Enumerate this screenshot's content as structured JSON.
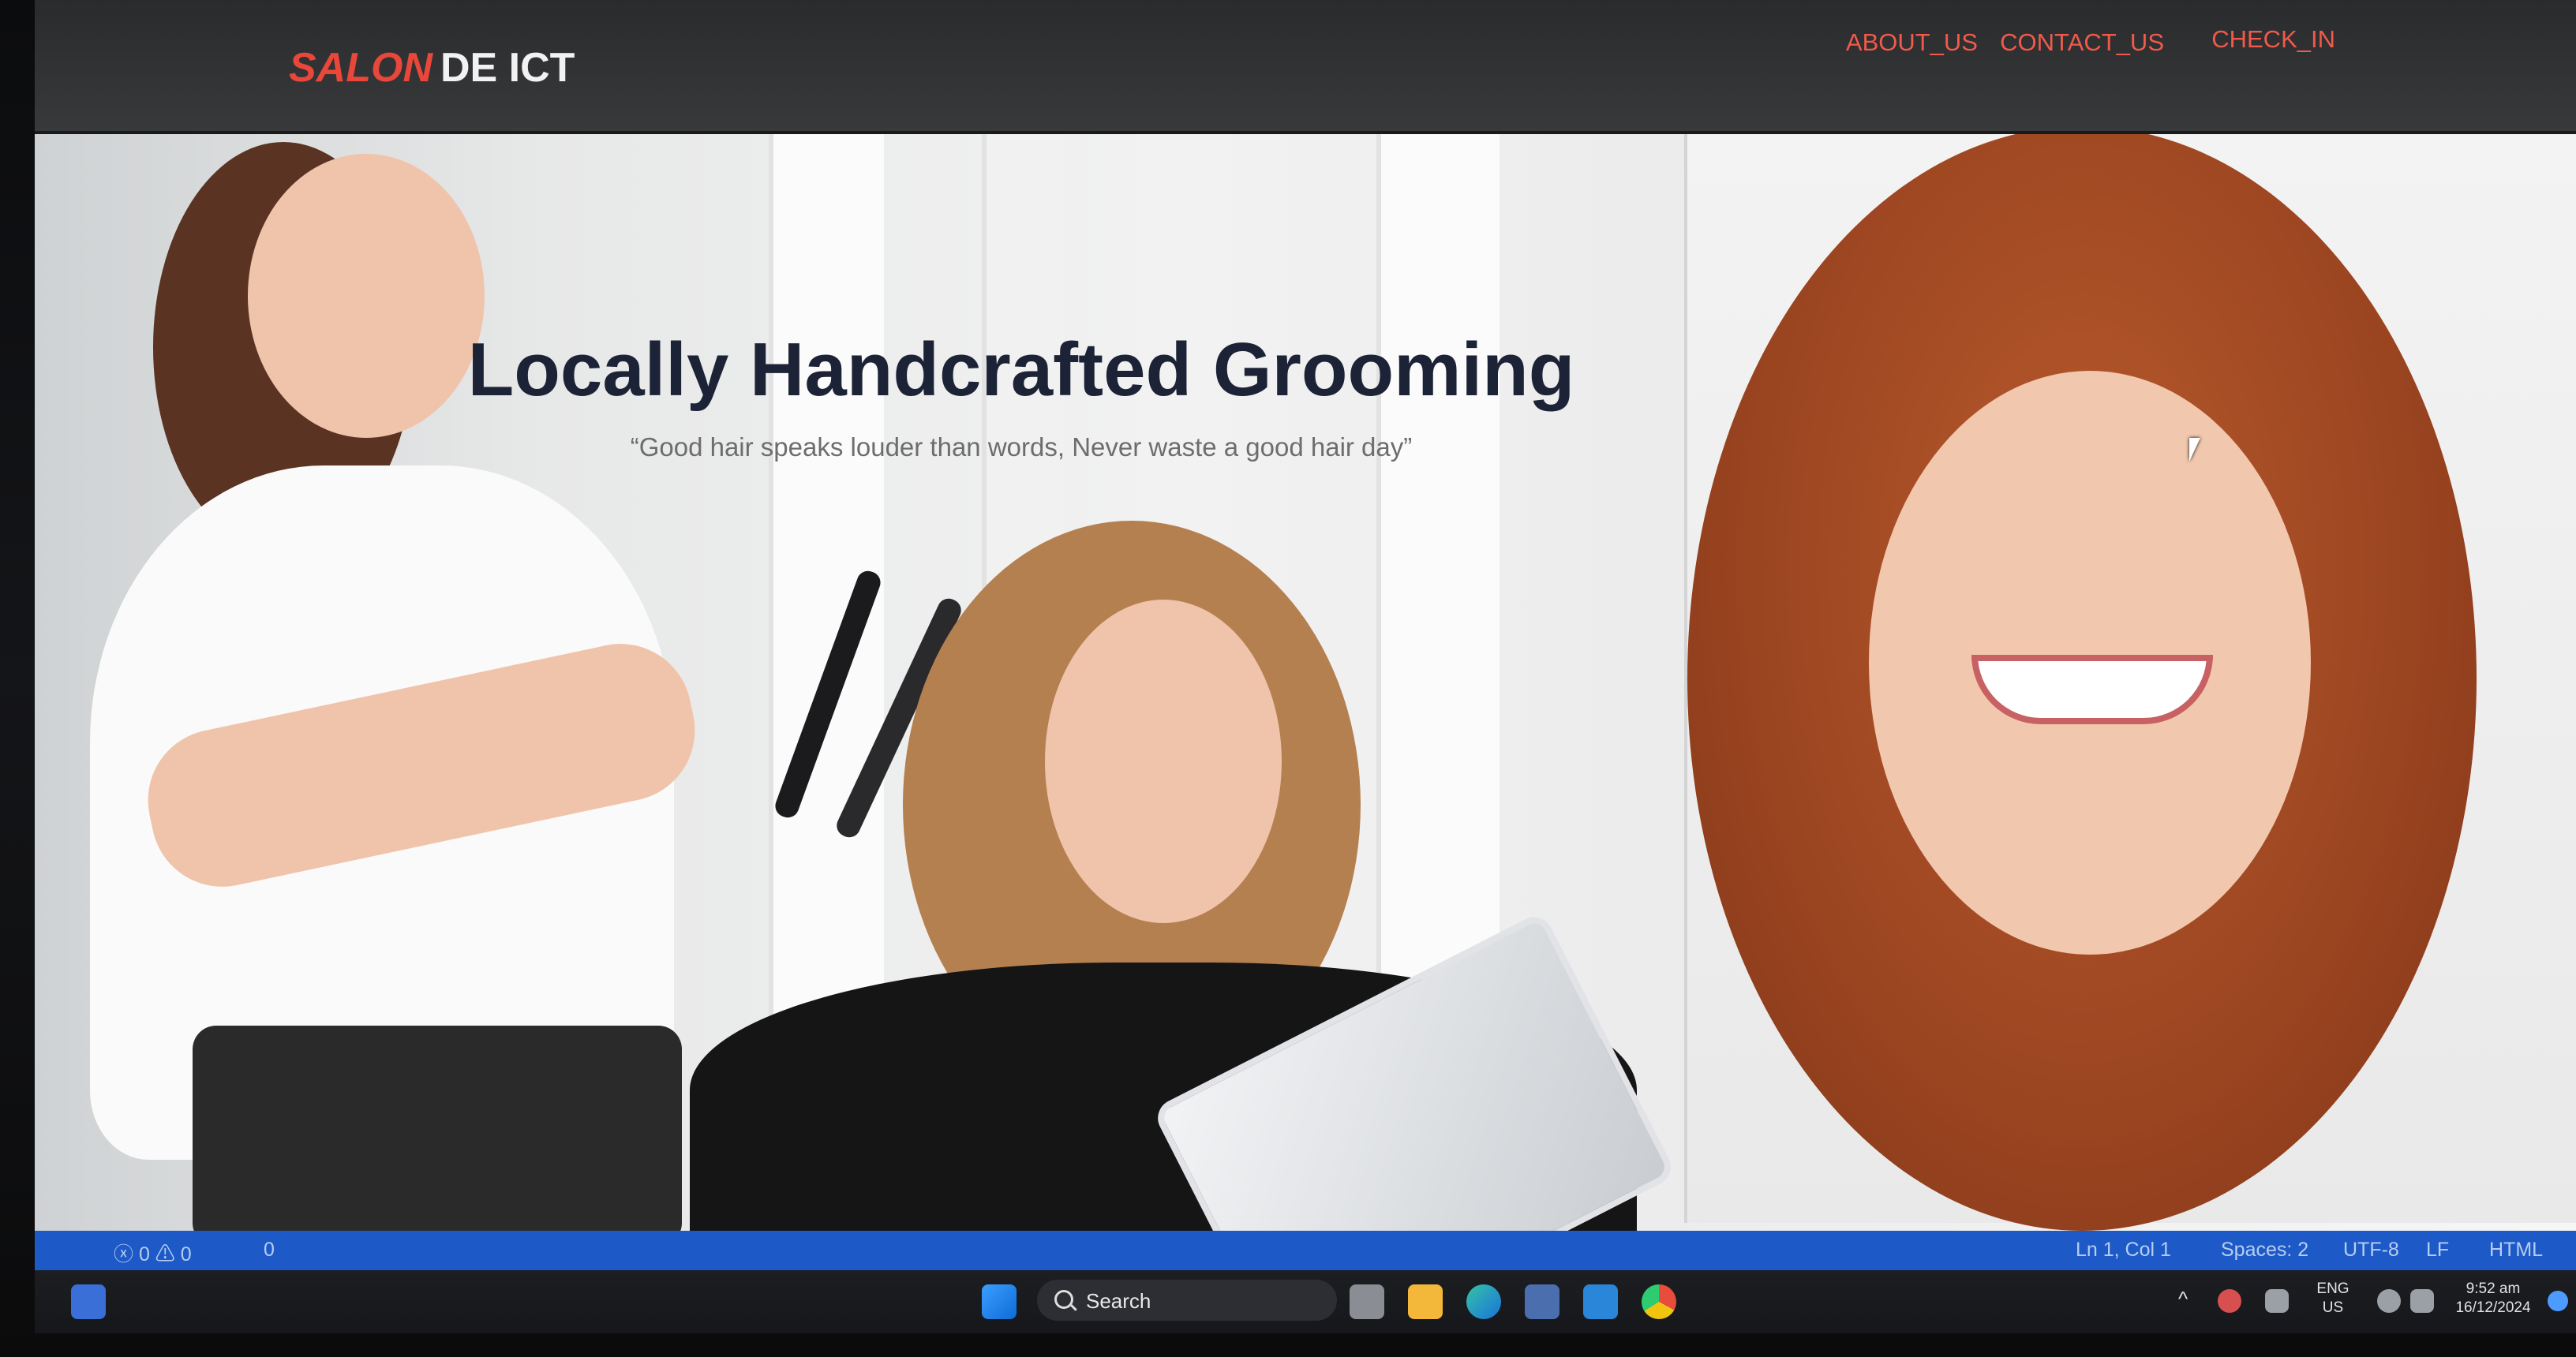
{
  "site": {
    "logo_part1": "SALON",
    "logo_part2": "DE ICT",
    "nav": [
      {
        "label": "ABOUT_US"
      },
      {
        "label": "CONTACT_US"
      },
      {
        "label": "CHECK_IN"
      }
    ],
    "hero_title": "Locally Handcrafted Grooming",
    "hero_subtitle": "“Good hair speaks louder than words, Never waste a good hair day”"
  },
  "status_bar": {
    "problems": "ⓧ 0 ⚠ 0",
    "ports": "0",
    "position": "Ln 1, Col 1",
    "spaces": "Spaces: 2",
    "encoding": "UTF-8",
    "eol": "LF",
    "language": "HTML"
  },
  "taskbar": {
    "search_label": "Search",
    "lang_line1": "ENG",
    "lang_line2": "US",
    "time": "9:52 am",
    "date": "16/12/2024"
  },
  "colors": {
    "accent_red": "#e8473a",
    "header_bg": "#2f3032",
    "status_blue": "#1d5ac7"
  }
}
